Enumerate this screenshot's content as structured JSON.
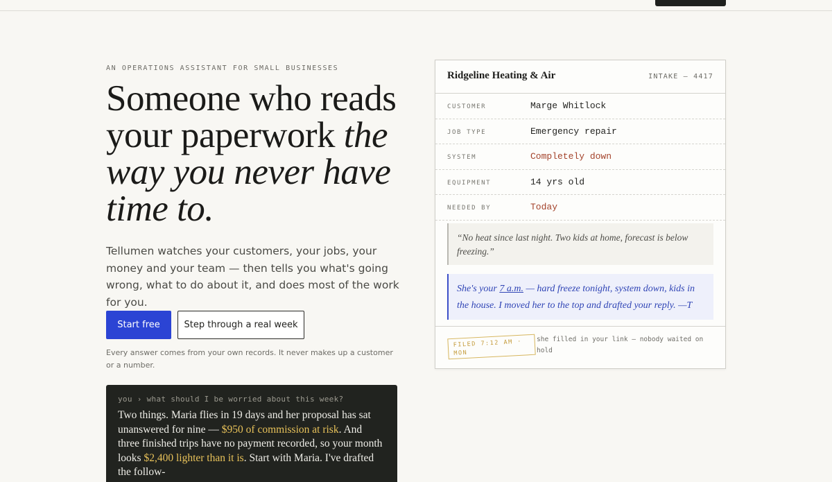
{
  "nav": {
    "top_button_label": ""
  },
  "hero": {
    "eyebrow": "AN OPERATIONS ASSISTANT FOR SMALL BUSINESSES",
    "headline_plain": "Someone who reads your paperwork ",
    "headline_italic": "the way you never have time to.",
    "subtext": "Tellumen watches your customers, your jobs, your money and your team — then tells you what's going wrong, what to do about it, and does most of the work for you.",
    "primary_button": "Start free",
    "secondary_button": "Step through a real week",
    "disclaimer": "Every answer comes from your own records. It never makes up a customer or a number."
  },
  "terminal": {
    "prompt_user": "you",
    "prompt_separator": "›",
    "prompt_text": "what should I be worried about this week?",
    "answer_1": "Two things. Maria flies in 19 days and her proposal has sat unanswered for nine — ",
    "answer_highlight_1": "$950 of commission at risk",
    "answer_2": ". And three finished trips have no payment recorded, so your month looks ",
    "answer_highlight_2": "$2,400 lighter than it is",
    "answer_3": ". Start with Maria. I've drafted the follow-"
  },
  "intake_card": {
    "company": "Ridgeline Heating & Air",
    "intake_id": "INTAKE — 4417",
    "fields": [
      {
        "label": "CUSTOMER",
        "value": "Marge Whitlock"
      },
      {
        "label": "JOB TYPE",
        "value": "Emergency repair"
      },
      {
        "label": "SYSTEM",
        "value": "Completely down"
      },
      {
        "label": "EQUIPMENT",
        "value": "14 yrs old"
      },
      {
        "label": "NEEDED BY",
        "value": "Today"
      }
    ],
    "customer_quote": "“No heat since last night. Two kids at home, forecast is below freezing.”",
    "note_prefix": "She's your ",
    "note_time": "7 a.m.",
    "note_rest": " — hard freeze tonight, system down, kids in the house. I moved her to the top and drafted your reply.  —T",
    "stamp": "FILED 7:12 AM · MON",
    "footer_text": "she filled in your link — nobody waited on hold"
  },
  "colors": {
    "background": "#f8f7f3",
    "primary_button": "#2b44d4",
    "terminal_bg": "#21231f",
    "terminal_highlight": "#e8c25a",
    "alert_value": "#a4432b",
    "note_blue": "#2f44b5",
    "stamp_gold": "#c49b3a"
  }
}
